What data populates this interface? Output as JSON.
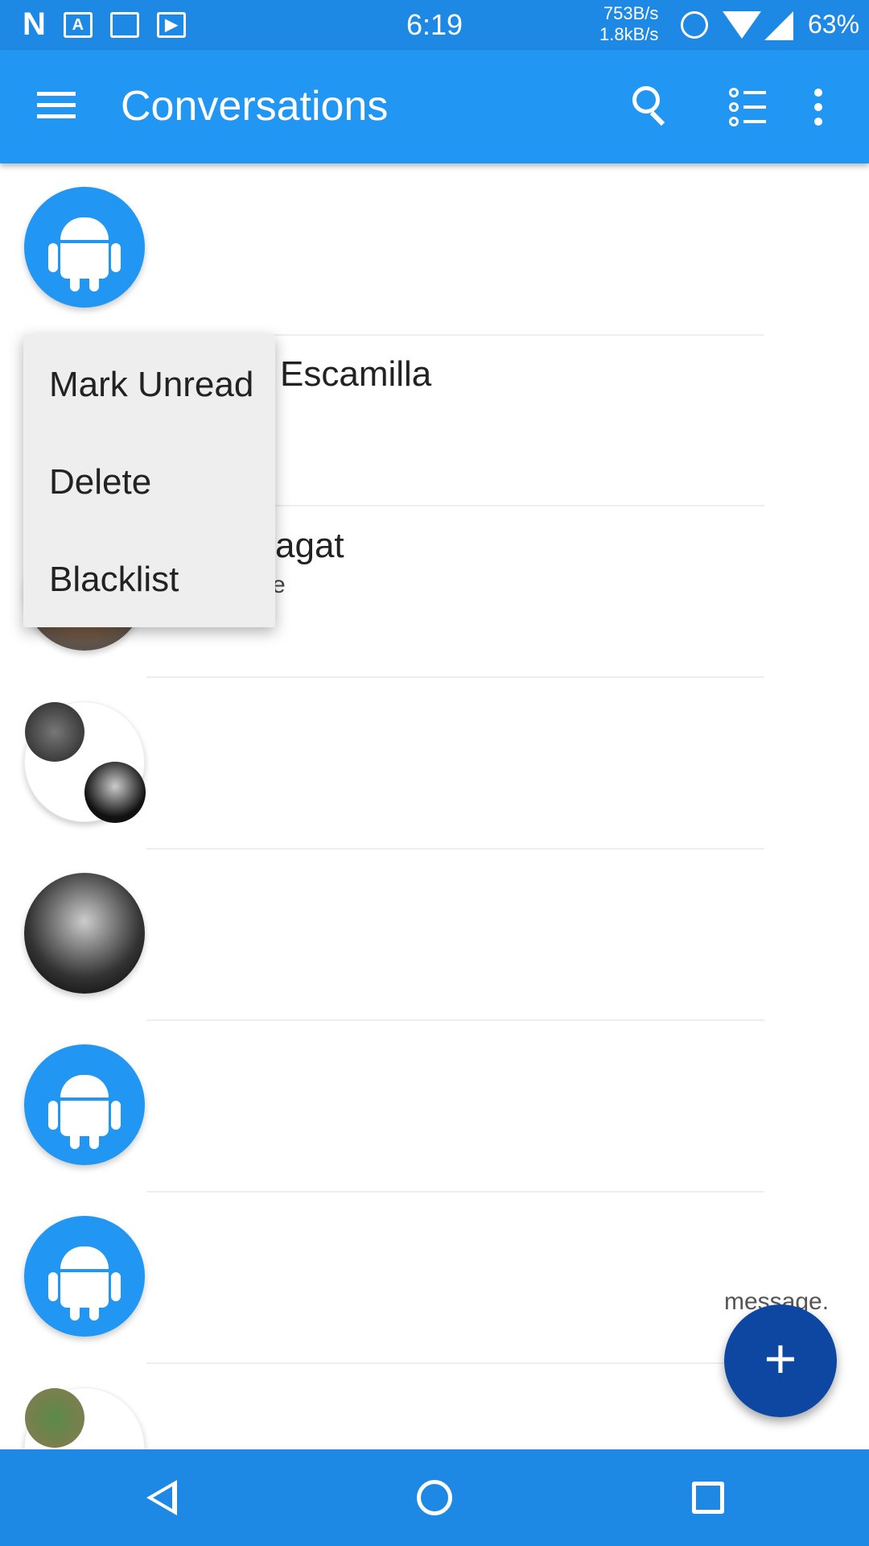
{
  "status_bar": {
    "time": "6:19",
    "net_up": "753B/s",
    "net_down": "1.8kB/s",
    "battery": "63%",
    "notif_icon": "N",
    "icons": [
      "n-icon",
      "text-icon",
      "image-icon",
      "play-store-icon",
      "alarm-icon",
      "wifi-icon",
      "signal-icon"
    ]
  },
  "toolbar": {
    "title": "Conversations",
    "icons": [
      "menu-icon",
      "search-icon",
      "filter-list-icon",
      "more-vert-icon"
    ]
  },
  "conversations": [
    {
      "avatar": "android-icon",
      "name": "",
      "snippet": ""
    },
    {
      "avatar": "photo",
      "name": "Escamilla",
      "snippet": ""
    },
    {
      "avatar": "photo",
      "name": "agat",
      "snippet": "e"
    },
    {
      "avatar": "group-photo",
      "name": "",
      "snippet": ""
    },
    {
      "avatar": "photo",
      "name": "",
      "snippet": ""
    },
    {
      "avatar": "android-icon",
      "name": "",
      "snippet": ""
    },
    {
      "avatar": "android-icon",
      "name": "",
      "snippet": "message."
    },
    {
      "avatar": "group-photo",
      "name": "",
      "snippet": ""
    }
  ],
  "context_menu": {
    "items": [
      "Mark Unread",
      "Delete",
      "Blacklist"
    ]
  },
  "fab": {
    "label": "+"
  },
  "colors": {
    "primary": "#2196F3",
    "status": "#1E88E5",
    "fab": "#0D47A1",
    "menu_bg": "#EEEEEE"
  }
}
